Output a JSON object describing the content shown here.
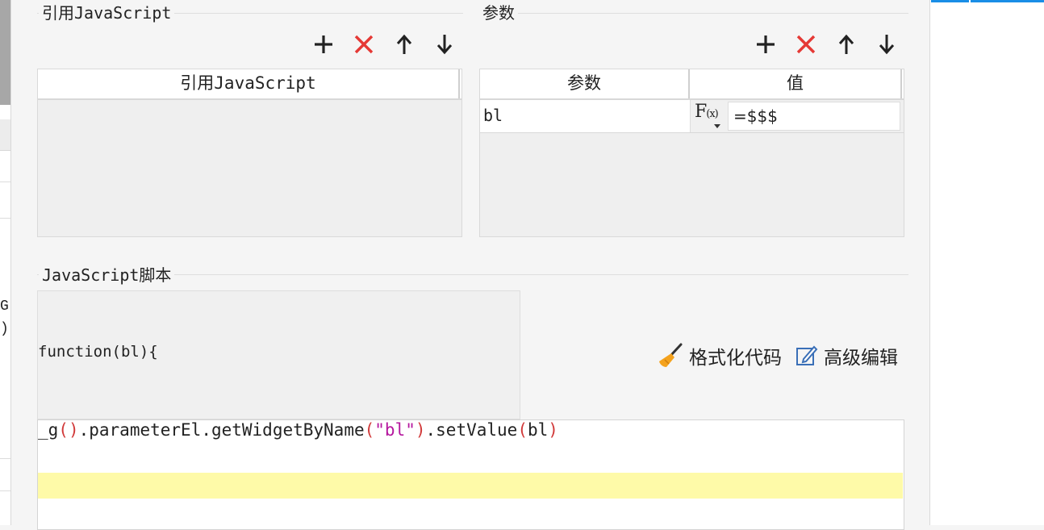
{
  "left_edge": {
    "glyph1": "G",
    "glyph2": ")"
  },
  "ref_js": {
    "title": "引用JavaScript",
    "column": "引用JavaScript"
  },
  "params": {
    "title": "参数",
    "columns": [
      "参数",
      "值"
    ],
    "rows": [
      {
        "name": "bl",
        "value": "=$$$"
      }
    ],
    "fx_label": "F(x)"
  },
  "toolbar": {
    "add": "add-icon",
    "remove": "delete-icon",
    "up": "arrow-up-icon",
    "down": "arrow-down-icon"
  },
  "script": {
    "title": "JavaScript脚本",
    "function_header": "function(bl){",
    "code_parts": [
      "_g",
      "(",
      ")",
      ".parameterEl.getWidgetByName",
      "(",
      "\"bl\"",
      ")",
      ".setValue",
      "(",
      "bl",
      ")"
    ],
    "format_label": "格式化代码",
    "advanced_label": "高级编辑"
  },
  "colors": {
    "accent_blue": "#1a8ee6",
    "delete_red": "#e53935",
    "highlight_line": "#fefaa8",
    "string": "#b5179e",
    "paren": "#d13a3a"
  }
}
